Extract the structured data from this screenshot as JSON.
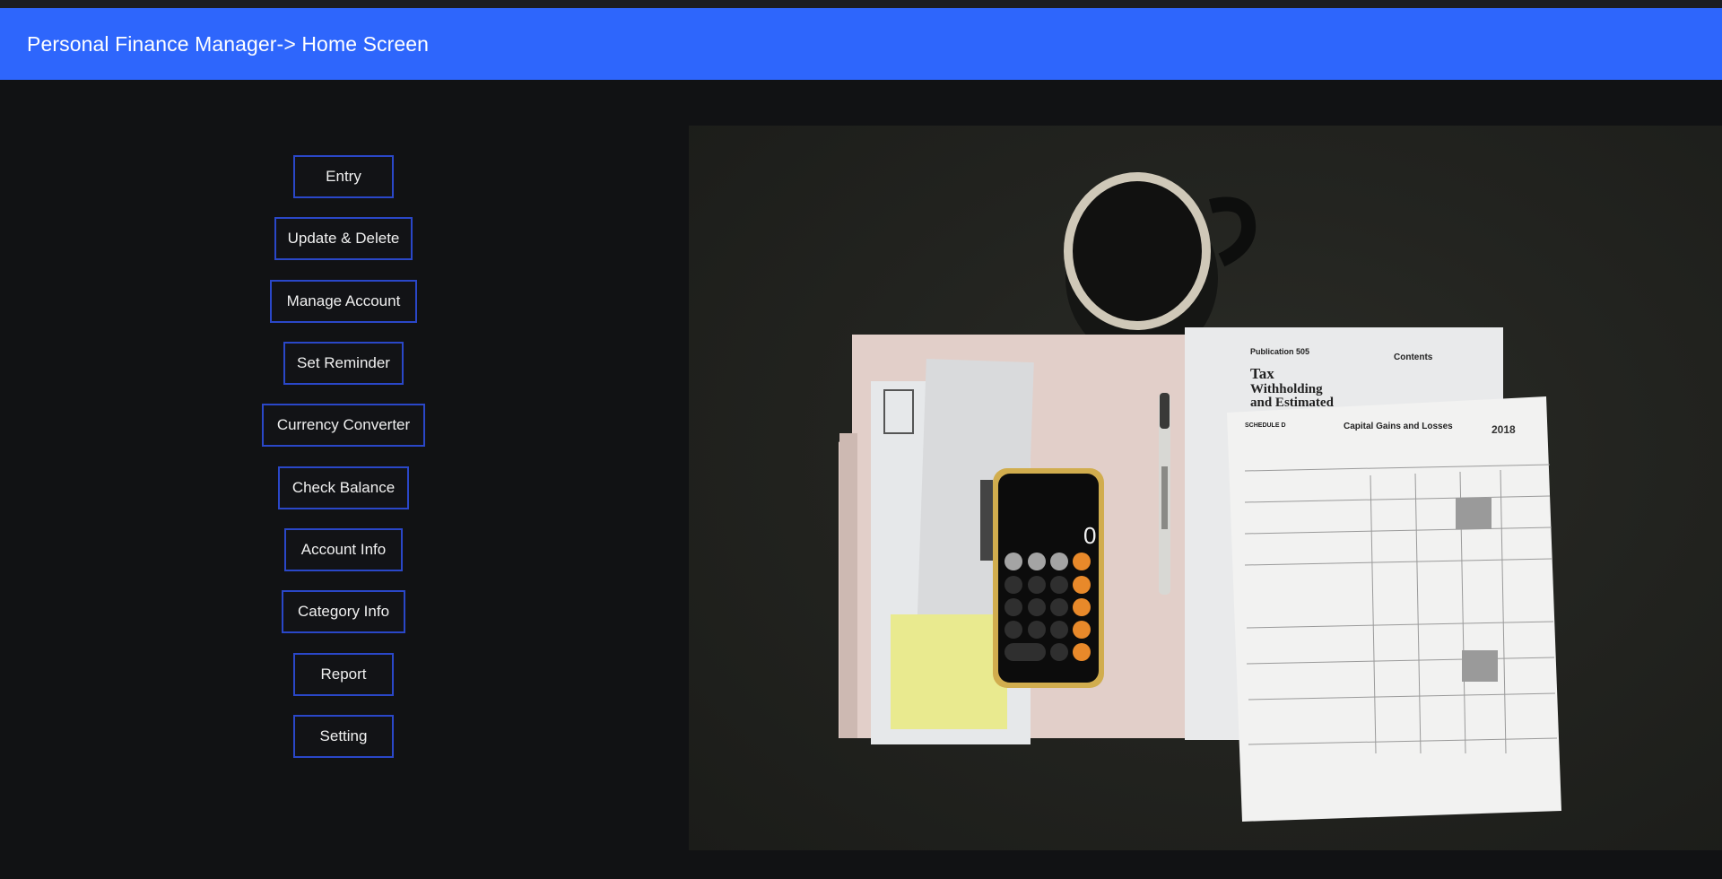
{
  "header": {
    "title": "Personal Finance Manager-> Home Screen",
    "bg_color": "#2e66fc"
  },
  "menu": {
    "border_color": "#2a47c8",
    "items": [
      {
        "label": "Entry"
      },
      {
        "label": "Update & Delete"
      },
      {
        "label": "Manage Account"
      },
      {
        "label": "Set Reminder"
      },
      {
        "label": "Currency Converter"
      },
      {
        "label": "Check Balance"
      },
      {
        "label": "Account Info"
      },
      {
        "label": "Category Info"
      },
      {
        "label": "Report"
      },
      {
        "label": "Setting"
      }
    ]
  },
  "hero_image": {
    "publication_label": "Publication 505",
    "doc_title_line1": "Tax",
    "doc_title_line2": "Withholding",
    "doc_title_line3": "and Estimated",
    "contents_label": "Contents",
    "schedule_title": "Capital Gains and Losses",
    "schedule_label": "SCHEDULE D",
    "year": "2018",
    "calc_display": "0"
  }
}
